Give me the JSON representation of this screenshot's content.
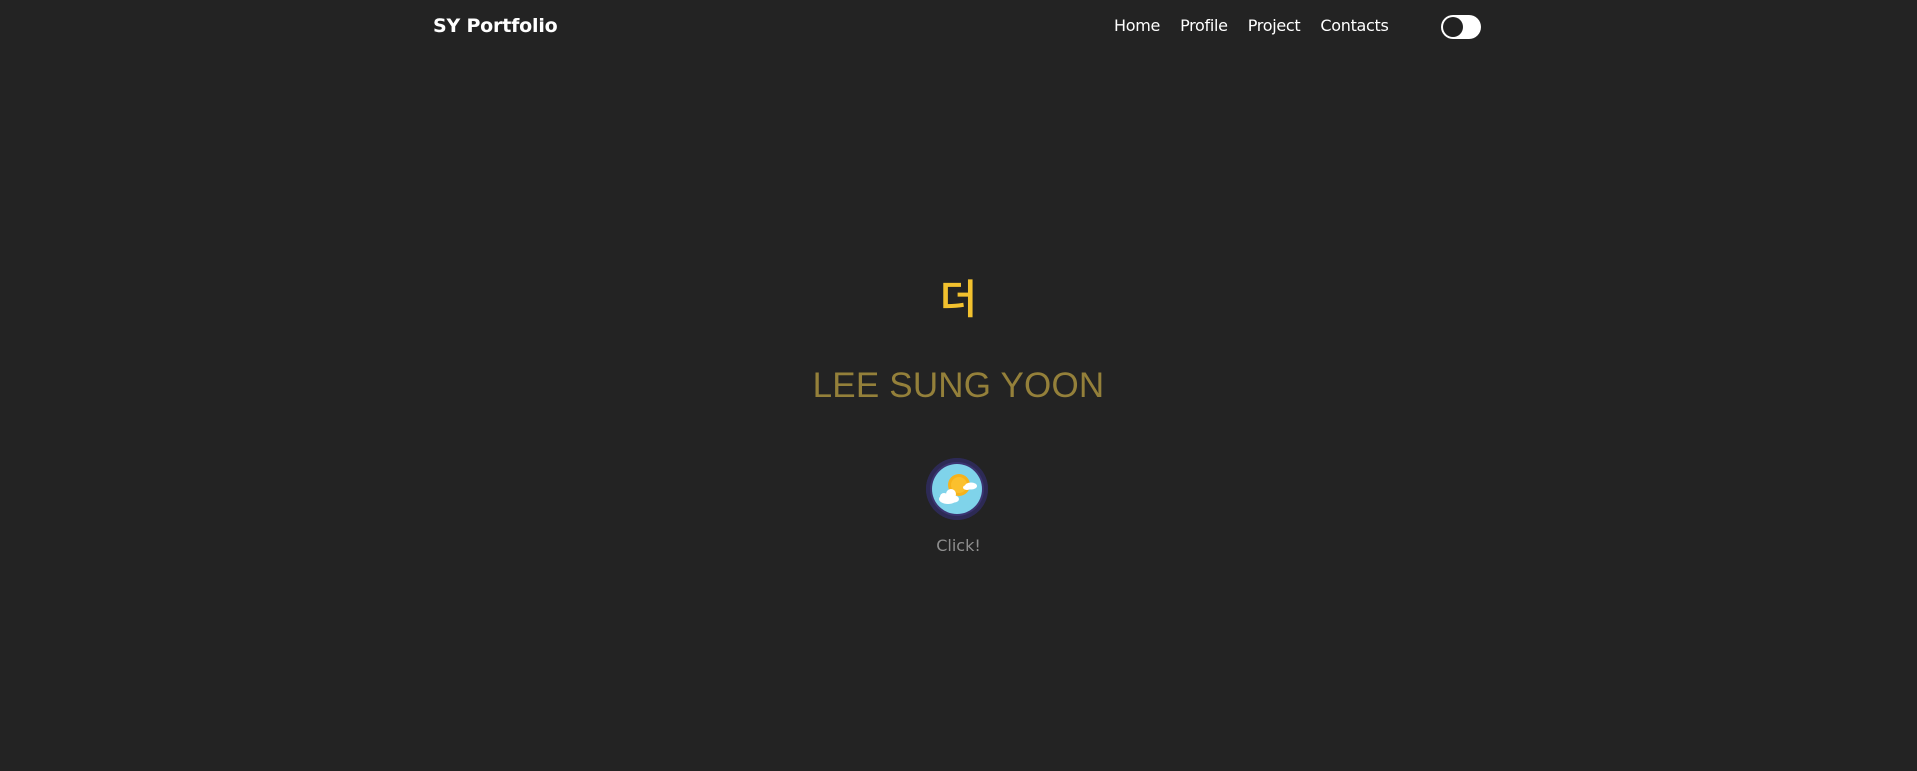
{
  "header": {
    "brand": "SY Portfolio",
    "nav": [
      {
        "label": "Home"
      },
      {
        "label": "Profile"
      },
      {
        "label": "Project"
      },
      {
        "label": "Contacts"
      }
    ],
    "theme_toggle": {
      "state": "off",
      "icon": "toggle-switch"
    }
  },
  "hero": {
    "glyph": "더",
    "name": "LEE SUNG YOON",
    "weather_button": {
      "icon": "sun-cloud-icon"
    },
    "click_label": "Click!"
  },
  "colors": {
    "background": "#232323",
    "accent_yellow": "#f2c12e",
    "name_gold": "#94803a",
    "muted_text": "#8e8e8e",
    "sky_blue": "#7fd3ea",
    "ring_purple": "#2d2a55"
  }
}
